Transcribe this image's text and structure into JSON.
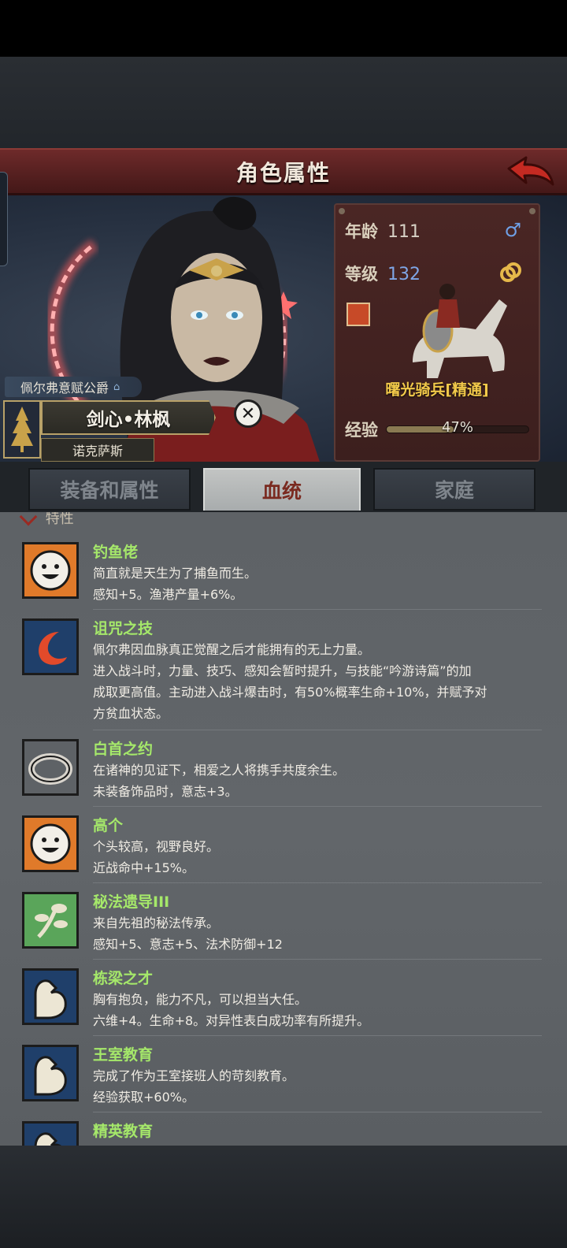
{
  "header": {
    "title": "角色属性",
    "back_icon": "back-arrow-icon"
  },
  "character": {
    "title_tag": "佩尔弗意赋公爵",
    "name": "剑心•林枫",
    "realm": "诺克萨斯"
  },
  "stats": {
    "age_label": "年龄",
    "age_value": "111",
    "level_label": "等级",
    "level_value": "132",
    "unit_name": "曙光骑兵[精通]",
    "exp_label": "经验",
    "exp_percent": "47%",
    "exp_fraction": 0.47
  },
  "tabs": [
    {
      "label": "装备和属性",
      "active": false
    },
    {
      "label": "血统",
      "active": true
    },
    {
      "label": "家庭",
      "active": false
    }
  ],
  "section": {
    "label": "特性"
  },
  "traits": [
    {
      "icon": "smiley-icon",
      "name": "钓鱼佬",
      "lines": [
        "简直就是天生为了捕鱼而生。",
        "感知+5。渔港产量+6%。"
      ]
    },
    {
      "icon": "crescent-curse-icon",
      "name": "诅咒之技",
      "lines": [
        "佩尔弗因血脉真正觉醒之后才能拥有的无上力量。",
        "进入战斗时，力量、技巧、感知会暂时提升，与技能“吟游诗篇”的加",
        "成取更高值。主动进入战斗爆击时，有50%概率生命+10%，并赋予对",
        "方贫血状态。"
      ]
    },
    {
      "icon": "ring-icon",
      "name": "白首之约",
      "lines": [
        "在诸神的见证下，相爱之人将携手共度余生。",
        "未装备饰品时，意志+3。"
      ]
    },
    {
      "icon": "smiley-icon",
      "name": "高个",
      "lines": [
        "个头较高，视野良好。",
        "近战命中+15%。"
      ]
    },
    {
      "icon": "sprout-icon",
      "name": "秘法遗导III",
      "lines": [
        "来自先祖的秘法传承。",
        "感知+5、意志+5、法术防御+12"
      ]
    },
    {
      "icon": "flex-arm-icon",
      "name": "栋梁之才",
      "lines": [
        "胸有抱负，能力不凡，可以担当大任。",
        "六维+4。生命+8。对异性表白成功率有所提升。"
      ]
    },
    {
      "icon": "flex-arm-icon",
      "name": "王室教育",
      "lines": [
        "完成了作为王室接班人的苛刻教育。",
        "经验获取+60%。"
      ]
    },
    {
      "icon": "flex-arm-icon",
      "name": "精英教育",
      "lines": []
    }
  ]
}
